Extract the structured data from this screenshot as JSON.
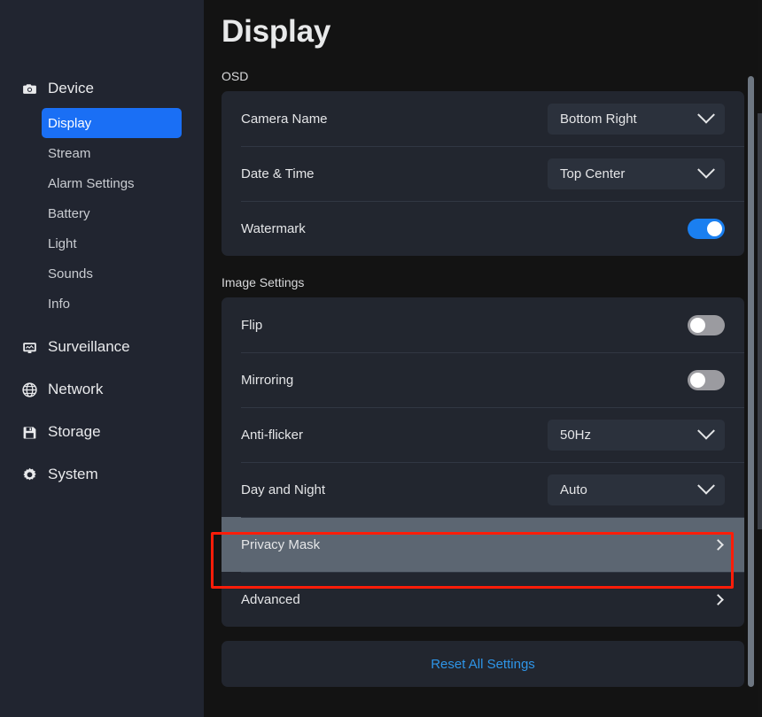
{
  "sidebar": {
    "groups": [
      {
        "label": "Device",
        "icon": "camera-icon",
        "items": [
          {
            "label": "Display",
            "active": true
          },
          {
            "label": "Stream",
            "active": false
          },
          {
            "label": "Alarm Settings",
            "active": false
          },
          {
            "label": "Battery",
            "active": false
          },
          {
            "label": "Light",
            "active": false
          },
          {
            "label": "Sounds",
            "active": false
          },
          {
            "label": "Info",
            "active": false
          }
        ]
      }
    ],
    "main_items": [
      {
        "label": "Surveillance",
        "icon": "monitor-icon"
      },
      {
        "label": "Network",
        "icon": "globe-icon"
      },
      {
        "label": "Storage",
        "icon": "floppy-disk-icon"
      },
      {
        "label": "System",
        "icon": "gear-icon"
      }
    ]
  },
  "header": {
    "title": "Display"
  },
  "sections": [
    {
      "label": "OSD",
      "rows": [
        {
          "label": "Camera Name",
          "control": "select",
          "value": "Bottom Right"
        },
        {
          "label": "Date & Time",
          "control": "select",
          "value": "Top Center"
        },
        {
          "label": "Watermark",
          "control": "toggle",
          "state": "on"
        }
      ]
    },
    {
      "label": "Image Settings",
      "rows": [
        {
          "label": "Flip",
          "control": "toggle",
          "state": "off"
        },
        {
          "label": "Mirroring",
          "control": "toggle",
          "state": "off"
        },
        {
          "label": "Anti-flicker",
          "control": "select",
          "value": "50Hz"
        },
        {
          "label": "Day and Night",
          "control": "select",
          "value": "Auto"
        },
        {
          "label": "Privacy Mask",
          "control": "chevron",
          "highlighted": true
        },
        {
          "label": "Advanced",
          "control": "chevron",
          "highlighted": false
        }
      ]
    }
  ],
  "footer": {
    "reset_label": "Reset All Settings"
  },
  "colors": {
    "accent_blue": "#1a6ff5",
    "toggle_on": "#1a7ff0",
    "toggle_off": "#9b9ba0",
    "highlight_border": "#fe1d09",
    "highlight_row_bg": "#5c6672",
    "link_blue": "#2e95e8",
    "sidebar_bg": "#212530",
    "card_bg": "#22262f",
    "main_bg": "#131313"
  }
}
